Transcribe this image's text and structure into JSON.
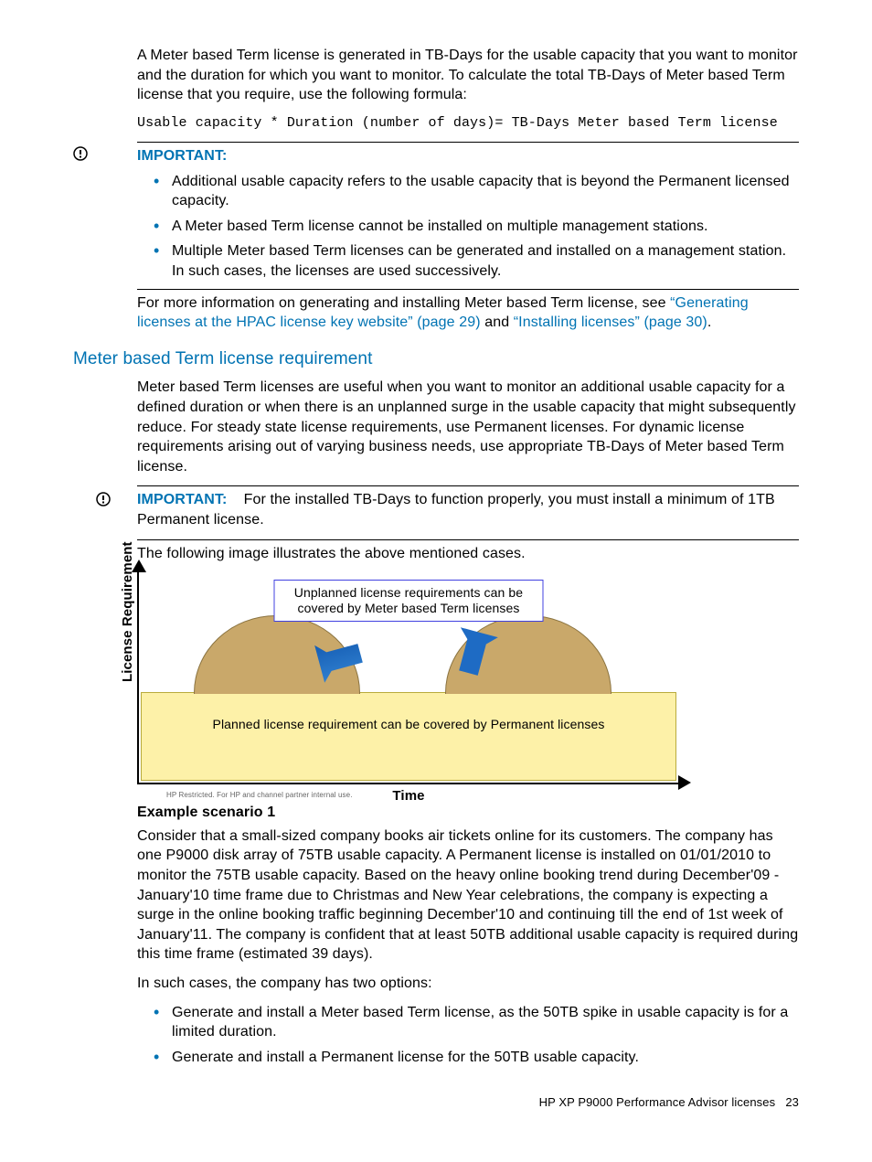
{
  "intro": {
    "p1": "A Meter based Term license is generated in TB-Days for the usable capacity that you want to monitor and the duration for which you want to monitor. To calculate the total TB-Days of Meter based Term license that you require, use the following formula:",
    "code": "Usable capacity * Duration (number of days)= TB-Days Meter based Term license"
  },
  "important1": {
    "label": "IMPORTANT:",
    "items": [
      "Additional usable capacity refers to the usable capacity that is beyond the Permanent licensed capacity.",
      "A Meter based Term license cannot be installed on multiple management stations.",
      "Multiple Meter based Term licenses can be generated and installed on a management station. In such cases, the licenses are used successively."
    ]
  },
  "moreinfo": {
    "pre": "For more information on generating and installing Meter based Term license, see ",
    "link1": "“Generating licenses at the HPAC license key website” (page 29)",
    "mid": " and ",
    "link2": "“Installing licenses” (page 30)",
    "post": "."
  },
  "section": {
    "title": "Meter based Term license requirement",
    "p1": "Meter based Term licenses are useful when you want to monitor an additional usable capacity for a defined duration or when there is an unplanned surge in the usable capacity that might subsequently reduce. For steady state license requirements, use Permanent licenses. For dynamic license requirements arising out of varying business needs, use appropriate TB-Days of Meter based Term license."
  },
  "important2": {
    "label": "IMPORTANT:",
    "text": "For the installed TB-Days to function properly, you must install a minimum of 1TB Permanent license."
  },
  "fig_intro": "The following image illustrates the above mentioned cases.",
  "figure": {
    "callout": "Unplanned license requirements can be covered by Meter based Term licenses",
    "planned": "Planned license requirement can be covered by Permanent licenses",
    "ylabel": "License Requirement",
    "xlabel": "Time",
    "footnote": "HP Restricted. For HP and channel partner internal use."
  },
  "example": {
    "heading": "Example scenario 1",
    "p1": "Consider that a small-sized company books air tickets online for its customers. The company has one P9000 disk array of 75TB usable capacity. A Permanent license is installed on 01/01/2010 to monitor the 75TB usable capacity. Based on the heavy online booking trend during December'09 - January'10 time frame due to Christmas and New Year celebrations, the company is expecting a surge in the online booking traffic beginning December'10 and continuing till the end of 1st week of January'11. The company is confident that at least 50TB additional usable capacity is required during this time frame (estimated 39 days).",
    "p2": "In such cases, the company has two options:",
    "options": [
      "Generate and install a Meter based Term license, as the 50TB spike in usable capacity is for a limited duration.",
      "Generate and install a Permanent license for the 50TB usable capacity."
    ]
  },
  "footer": {
    "text": "HP XP P9000 Performance Advisor licenses",
    "page": "23"
  }
}
